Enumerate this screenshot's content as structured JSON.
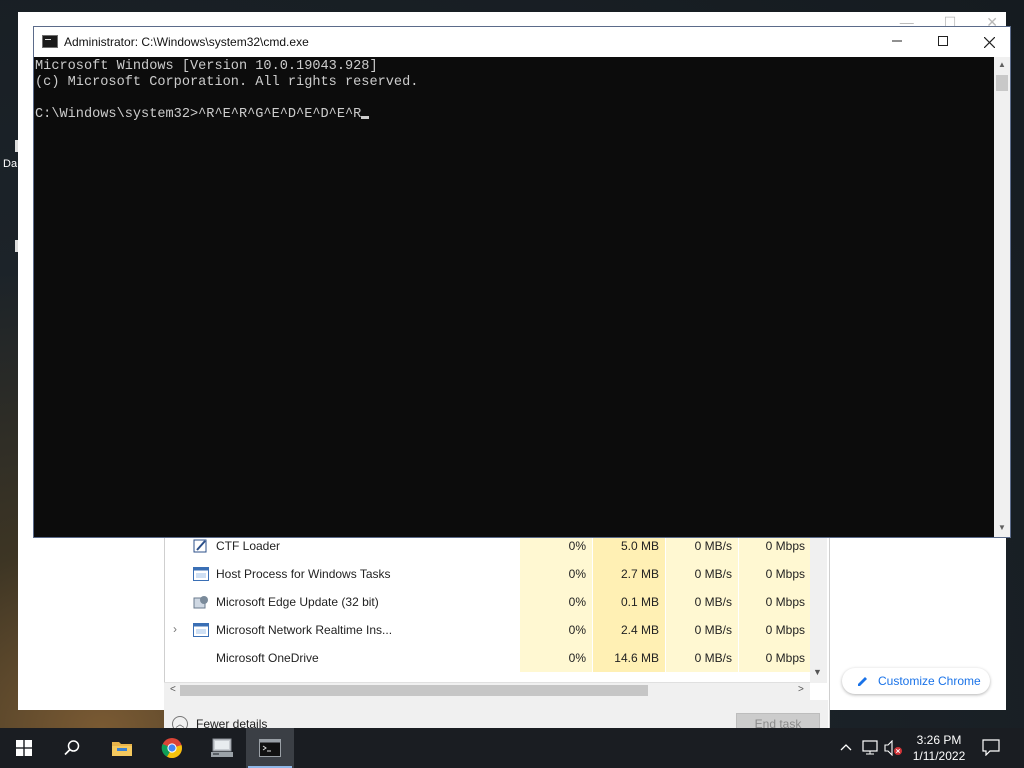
{
  "background_window": {
    "customize_label": "Customize Chrome"
  },
  "desktop": {
    "fragment_label": "Da"
  },
  "task_manager": {
    "rows": [
      {
        "name": "CTF Loader",
        "cpu": "0%",
        "memory": "5.0 MB",
        "disk": "0 MB/s",
        "network": "0 Mbps",
        "icon": "ctf-loader-icon",
        "expandable": false
      },
      {
        "name": "Host Process for Windows Tasks",
        "cpu": "0%",
        "memory": "2.7 MB",
        "disk": "0 MB/s",
        "network": "0 Mbps",
        "icon": "window-app-icon",
        "expandable": false
      },
      {
        "name": "Microsoft Edge Update (32 bit)",
        "cpu": "0%",
        "memory": "0.1 MB",
        "disk": "0 MB/s",
        "network": "0 Mbps",
        "icon": "edge-update-icon",
        "expandable": false
      },
      {
        "name": "Microsoft Network Realtime Ins...",
        "cpu": "0%",
        "memory": "2.4 MB",
        "disk": "0 MB/s",
        "network": "0 Mbps",
        "icon": "window-app-icon",
        "expandable": true
      },
      {
        "name": "Microsoft OneDrive",
        "cpu": "0%",
        "memory": "14.6 MB",
        "disk": "0 MB/s",
        "network": "0 Mbps",
        "icon": "",
        "expandable": false
      }
    ],
    "fewer_details_label": "Fewer details",
    "end_task_label": "End task"
  },
  "cmd_window": {
    "title": "Administrator: C:\\Windows\\system32\\cmd.exe",
    "lines": [
      "Microsoft Windows [Version 10.0.19043.928]",
      "(c) Microsoft Corporation. All rights reserved.",
      "",
      "C:\\Windows\\system32>^R^E^R^G^E^D^E^D^E^R"
    ]
  },
  "taskbar": {
    "pinned": [
      "start-icon",
      "search-icon",
      "file-explorer-icon",
      "chrome-icon",
      "server-manager-icon",
      "command-prompt-icon"
    ],
    "active": "command-prompt-icon",
    "time": "3:26 PM",
    "date": "1/11/2022"
  },
  "colors": {
    "console_bg": "#0c0c0c",
    "console_text": "#cccccc",
    "taskbar_bg": "#1a1d22",
    "accent_blue": "#1a73e8",
    "tm_highlight": "#fff4c4"
  }
}
